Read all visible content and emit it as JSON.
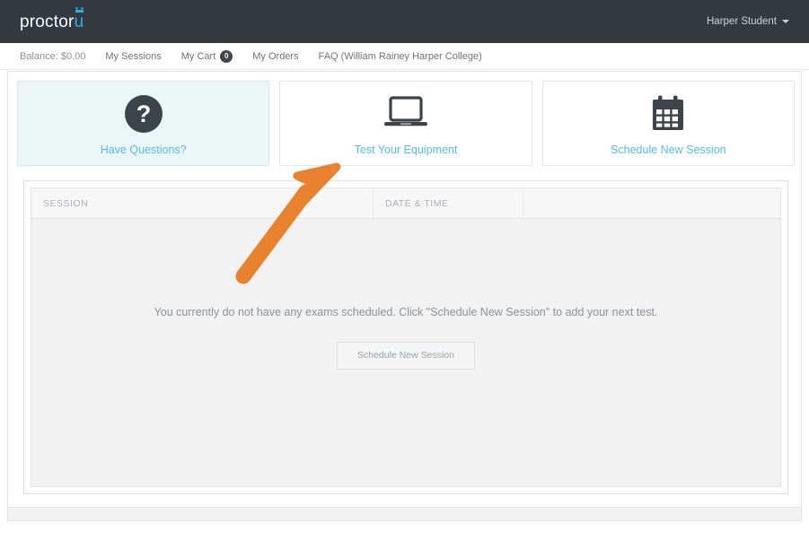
{
  "topbar": {
    "logo_word": "proctor",
    "logo_u": "u",
    "logo_icon": "owl-icon",
    "user_name": "Harper Student",
    "caret_icon": "chevron-down-icon"
  },
  "subnav": {
    "balance": "Balance: $0.00",
    "my_sessions": "My Sessions",
    "my_cart": "My Cart",
    "cart_count": "0",
    "my_orders": "My Orders",
    "faq": "FAQ (William Rainey Harper College)"
  },
  "cards": [
    {
      "label": "Have Questions?",
      "icon": "question-mark-circle-icon",
      "tinted": true
    },
    {
      "label": "Test Your Equipment",
      "icon": "laptop-icon",
      "tinted": false
    },
    {
      "label": "Schedule New Session",
      "icon": "calendar-icon",
      "tinted": false
    }
  ],
  "table": {
    "columns": [
      "SESSION",
      "DATE & TIME",
      ""
    ],
    "rows": [],
    "empty_message": "You currently do not have any exams scheduled. Click \"Schedule New Session\" to add your next test.",
    "empty_button": "Schedule New Session"
  },
  "annotation": {
    "type": "arrow",
    "points_to": "Test Your Equipment",
    "color": "#e8822e"
  },
  "colors": {
    "topbar_bg": "#343a40",
    "accent_blue": "#52bcea",
    "logo_blue": "#29b6e8",
    "card_tint": "#edf6f7",
    "annotation_orange": "#e8822e",
    "page_bg": "#ffffff",
    "table_body_bg": "#f2f2f2"
  }
}
